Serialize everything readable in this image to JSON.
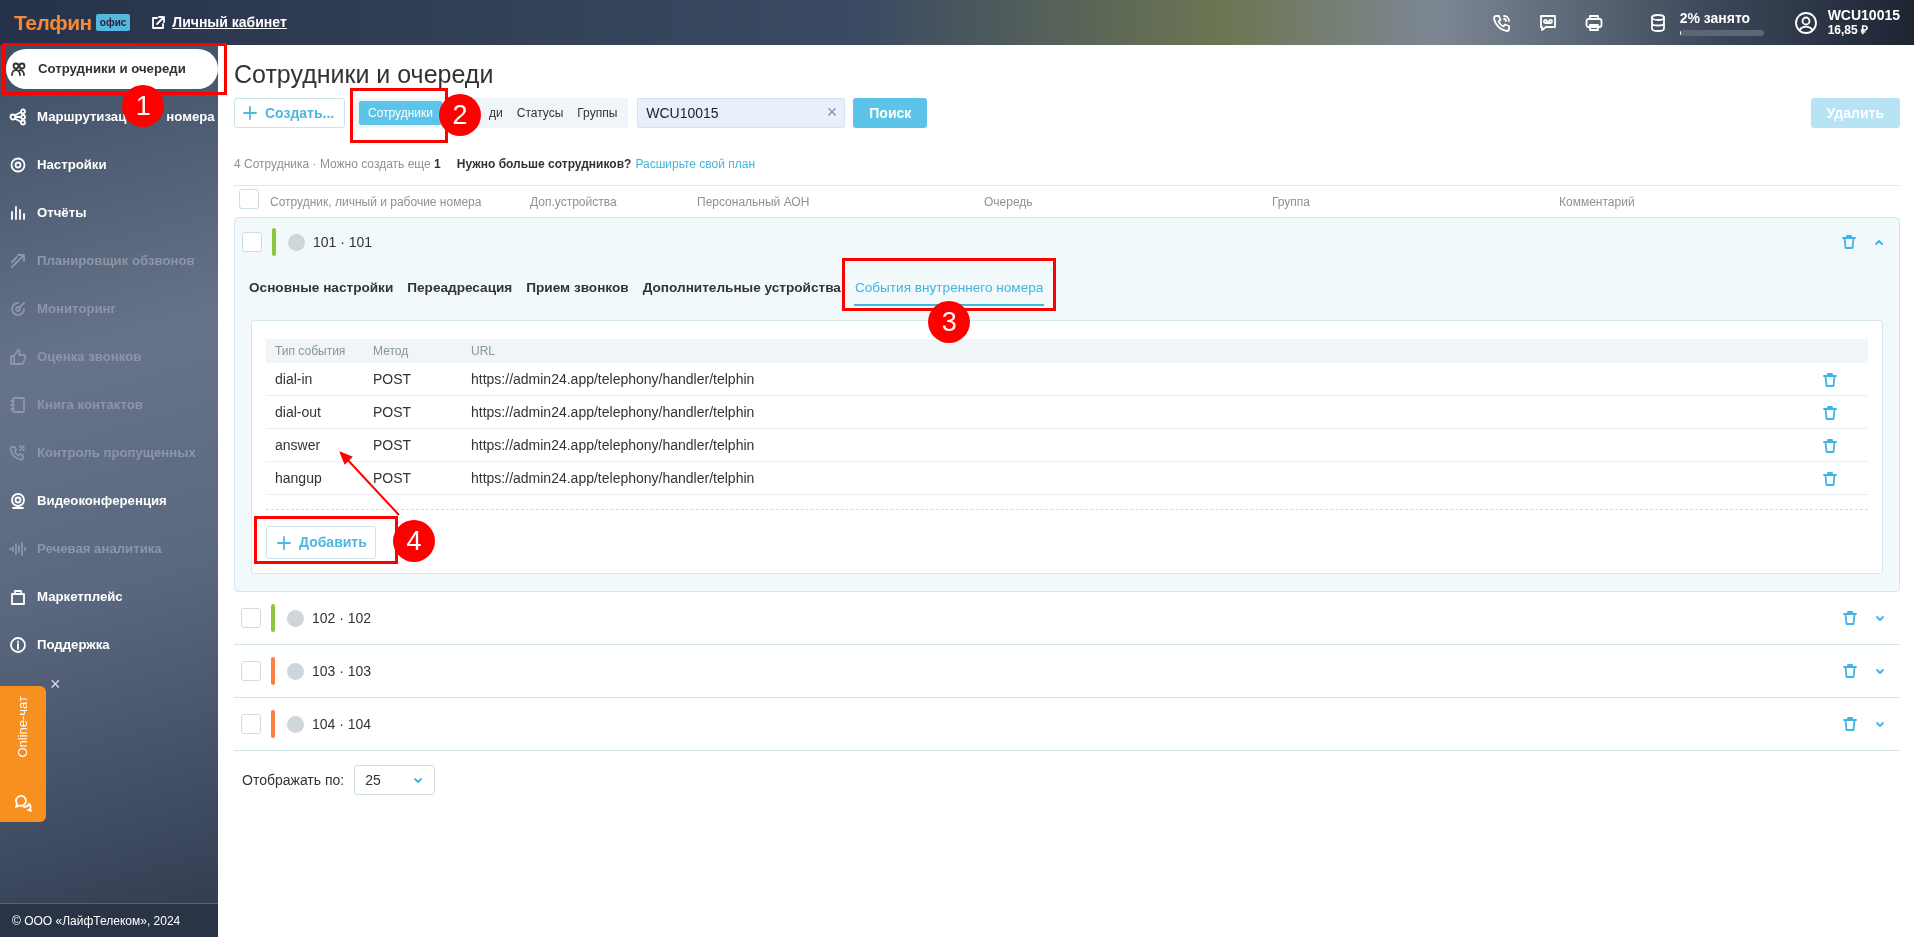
{
  "topbar": {
    "logo": "Телфин",
    "logo_badge": "офис",
    "cabinet_link": "Личный кабинет",
    "storage": {
      "label": "2% занято",
      "level": 0.02
    },
    "account": {
      "login": "WCU10015",
      "balance": "16,85 ₽"
    }
  },
  "sidebar": {
    "items": [
      {
        "label": "Сотрудники и очереди",
        "selected": true,
        "disabled": false
      },
      {
        "label": "Маршрутизац",
        "label_tail": "номера",
        "selected": false,
        "disabled": false
      },
      {
        "label": "Настройки",
        "selected": false,
        "disabled": false
      },
      {
        "label": "Отчёты",
        "selected": false,
        "disabled": false
      },
      {
        "label": "Планировщик обзвонов",
        "selected": false,
        "disabled": true
      },
      {
        "label": "Мониторинг",
        "selected": false,
        "disabled": true
      },
      {
        "label": "Оценка звонков",
        "selected": false,
        "disabled": true
      },
      {
        "label": "Книга контактов",
        "selected": false,
        "disabled": true
      },
      {
        "label": "Контроль пропущенных",
        "selected": false,
        "disabled": true
      },
      {
        "label": "Видеоконференция",
        "selected": false,
        "disabled": false
      },
      {
        "label": "Речевая аналитика",
        "selected": false,
        "disabled": true
      },
      {
        "label": "Маркетплейс",
        "selected": false,
        "disabled": false
      },
      {
        "label": "Поддержка",
        "selected": false,
        "disabled": false
      }
    ],
    "chat": {
      "label": "Online-чат",
      "close": "×"
    },
    "footer": "© ООО «ЛайфТелеком», 2024"
  },
  "page": {
    "title": "Сотрудники и очереди",
    "create_button": "Создать...",
    "views": [
      {
        "label": "Сотрудники",
        "selected": true
      },
      {
        "label": "ди",
        "selected": false
      },
      {
        "label": "Статусы",
        "selected": false
      },
      {
        "label": "Группы",
        "selected": false
      }
    ],
    "search": {
      "value": "WCU10015",
      "clear": "×"
    },
    "search_button": "Поиск",
    "delete_button": {
      "label": "Удалить",
      "disabled": true
    },
    "summary": {
      "count": "4 Сотрудника · Можно создать еще **1**",
      "upsell": "Нужно больше сотрудников?",
      "upsell_link": "Расширьте свой план"
    }
  },
  "table": {
    "all_checked": false,
    "columns": [
      "Сотрудник, личный и рабочие номера",
      "Доп.устройства",
      "Персональный АОН",
      "Очередь",
      "Группа",
      "Комментарий"
    ],
    "rows": [
      {
        "label": "101 · 101",
        "checked": false,
        "color": "#8cc63f",
        "expanded": true,
        "tabs": [
          {
            "label": "Основные настройки",
            "selected": false
          },
          {
            "label": "Переадресация",
            "selected": false
          },
          {
            "label": "Прием звонков",
            "selected": false
          },
          {
            "label": "Дополнительные устройства",
            "selected": false
          },
          {
            "label": "События внутреннего номера",
            "selected": true
          }
        ],
        "events": {
          "columns": [
            "Тип события",
            "Метод",
            "URL"
          ],
          "rows": [
            {
              "type": "dial-in",
              "method": "POST",
              "url": "https://admin24.app/telephony/handler/telphin"
            },
            {
              "type": "dial-out",
              "method": "POST",
              "url": "https://admin24.app/telephony/handler/telphin"
            },
            {
              "type": "answer",
              "method": "POST",
              "url": "https://admin24.app/telephony/handler/telphin"
            },
            {
              "type": "hangup",
              "method": "POST",
              "url": "https://admin24.app/telephony/handler/telphin"
            }
          ]
        },
        "add_button": "Добавить"
      },
      {
        "label": "102 · 102",
        "checked": false,
        "color": "#8cc63f",
        "expanded": false
      },
      {
        "label": "103 · 103",
        "checked": false,
        "color": "#ff7f3f",
        "expanded": false
      },
      {
        "label": "104 · 104",
        "checked": false,
        "color": "#ff7f3f",
        "expanded": false
      }
    ]
  },
  "pagination": {
    "label": "Отображать по:",
    "value": "25"
  },
  "annotations": [
    {
      "label": "1",
      "arrow": false
    },
    {
      "label": "2",
      "arrow": false
    },
    {
      "label": "3",
      "arrow": false
    },
    {
      "label": "4",
      "arrow": true
    }
  ]
}
